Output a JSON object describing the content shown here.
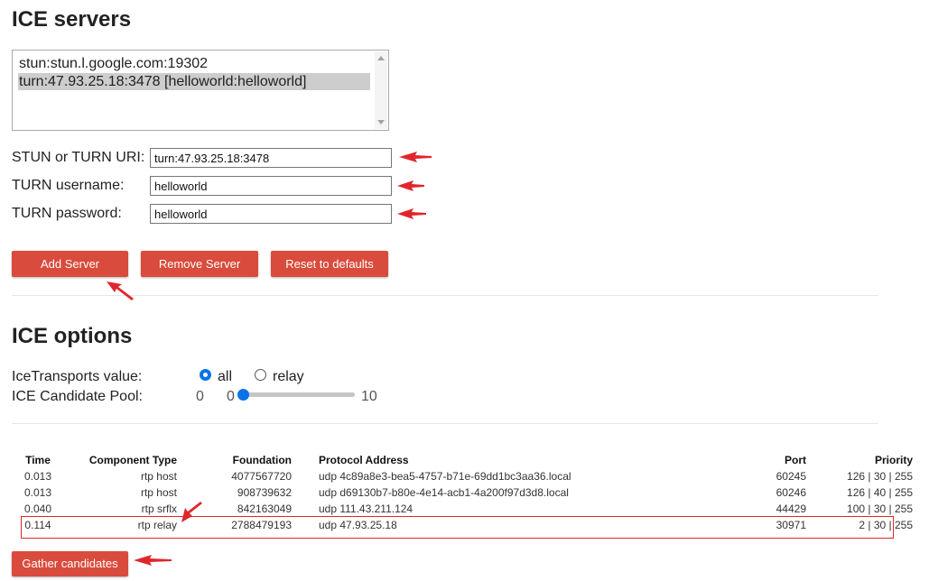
{
  "ice_servers": {
    "heading": "ICE servers",
    "list": [
      "stun:stun.l.google.com:19302",
      "turn:47.93.25.18:3478 [helloworld:helloworld]"
    ],
    "selected_index": 1,
    "uri_label": "STUN or TURN URI:",
    "uri_value": "turn:47.93.25.18:3478",
    "username_label": "TURN username:",
    "username_value": "helloworld",
    "password_label": "TURN password:",
    "password_value": "helloworld",
    "add_button": "Add Server",
    "remove_button": "Remove Server",
    "reset_button": "Reset to defaults"
  },
  "ice_options": {
    "heading": "ICE options",
    "transports_label": "IceTransports value:",
    "transport_all": "all",
    "transport_relay": "relay",
    "selected_transport": "all",
    "pool_label": "ICE Candidate Pool:",
    "pool_value": "0",
    "pool_min": "0",
    "pool_max": "10"
  },
  "candidates": {
    "headers": {
      "time": "Time",
      "component": "Component Type",
      "foundation": "Foundation",
      "protocol": "Protocol Address",
      "port": "Port",
      "priority": "Priority"
    },
    "rows": [
      {
        "time": "0.013",
        "component": "rtp host",
        "foundation": "4077567720",
        "protocol": "udp 4c89a8e3-bea5-4757-b71e-69dd1bc3aa36.local",
        "port": "60245",
        "priority": "126 | 30 | 255"
      },
      {
        "time": "0.013",
        "component": "rtp host",
        "foundation": "908739632",
        "protocol": "udp d69130b7-b80e-4e14-acb1-4a200f97d3d8.local",
        "port": "60246",
        "priority": "126 | 40 | 255"
      },
      {
        "time": "0.040",
        "component": "rtp srflx",
        "foundation": "842163049",
        "protocol": "udp 111.43.211.124",
        "port": "44429",
        "priority": "100 | 30 | 255"
      },
      {
        "time": "0.114",
        "component": "rtp relay",
        "foundation": "2788479193",
        "protocol": "udp 47.93.25.18",
        "port": "30971",
        "priority": "2 | 30 | 255"
      }
    ],
    "highlighted_row": 3
  },
  "gather_button": "Gather candidates",
  "colors": {
    "button": "#d94b3c",
    "annotation": "#e0262d",
    "accent": "#0b73e6"
  }
}
